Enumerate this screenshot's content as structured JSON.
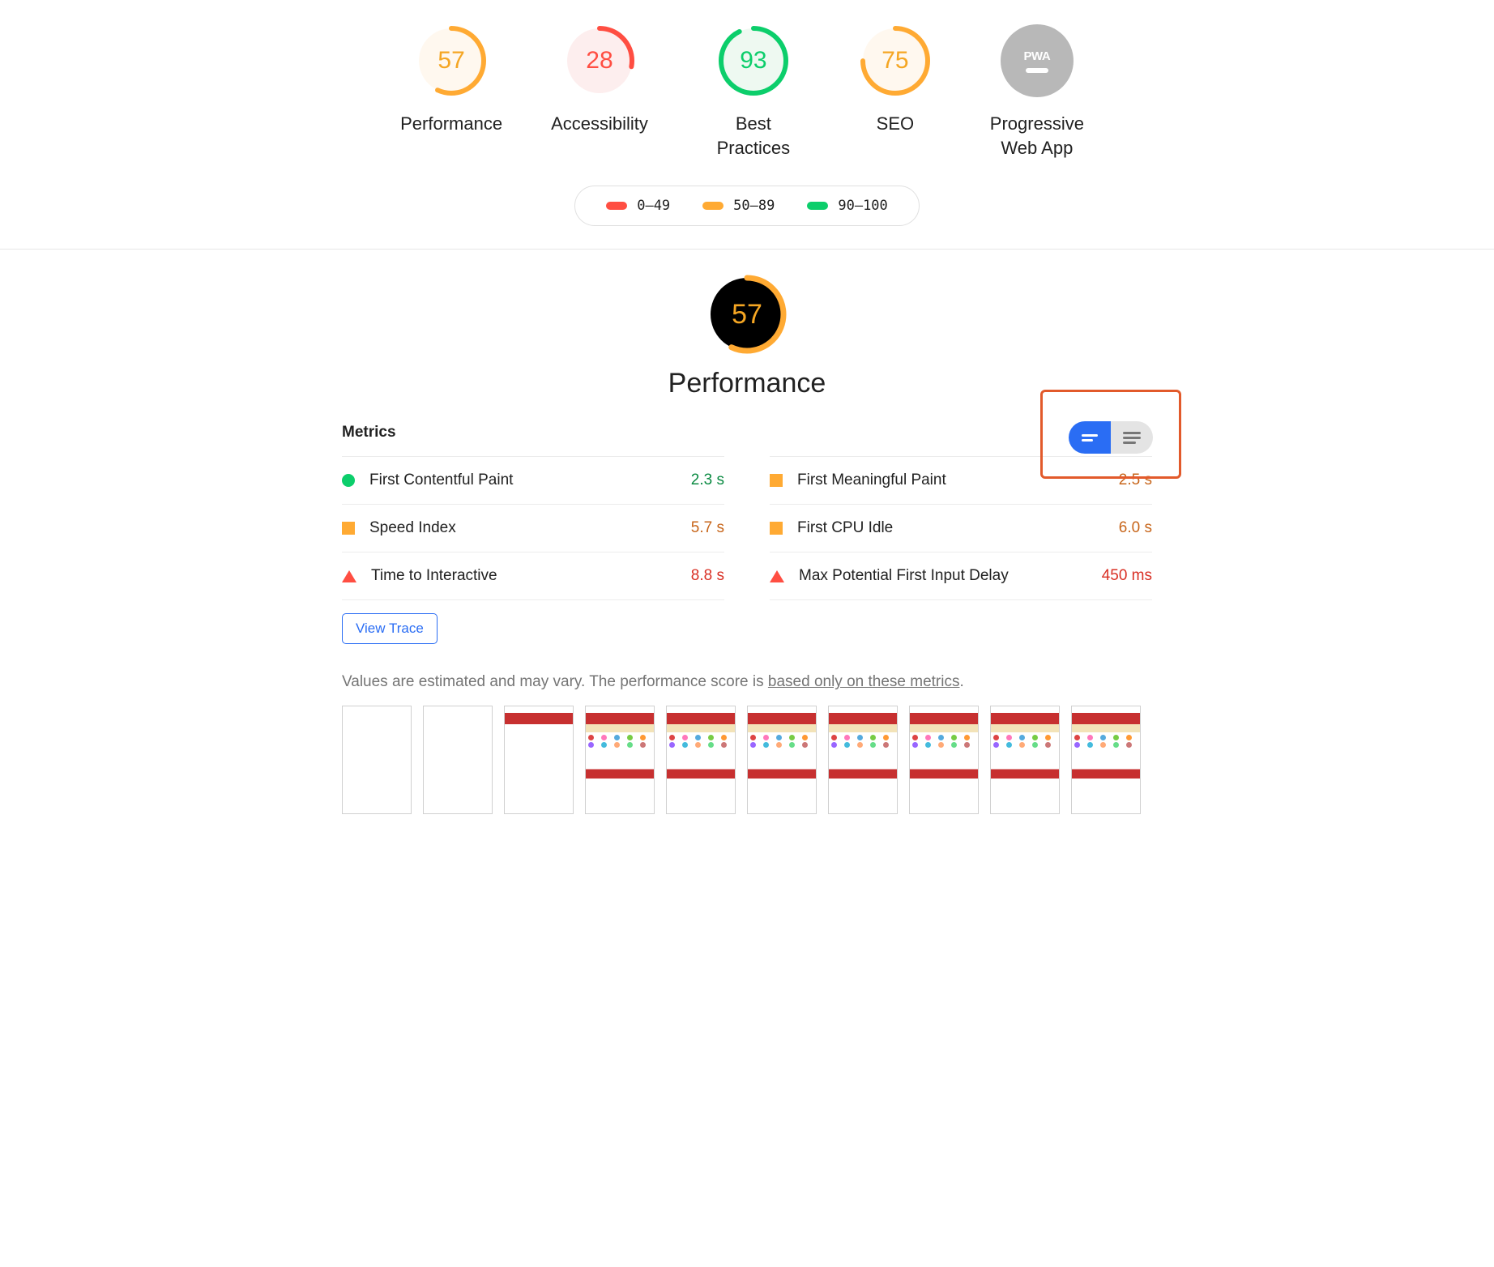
{
  "summary": {
    "gauges": [
      {
        "score": 57,
        "label": "Performance",
        "status": "orange"
      },
      {
        "score": 28,
        "label": "Accessibility",
        "status": "red"
      },
      {
        "score": 93,
        "label": "Best Practices",
        "status": "green"
      },
      {
        "score": 75,
        "label": "SEO",
        "status": "orange"
      }
    ],
    "pwa_label": "Progressive Web App",
    "pwa_badge_text": "PWA"
  },
  "legend": {
    "fail": "0–49",
    "average": "50–89",
    "pass": "90–100"
  },
  "chart_data": [
    {
      "type": "pie",
      "title": "Performance",
      "values": [
        57
      ],
      "ylim": [
        0,
        100
      ]
    },
    {
      "type": "pie",
      "title": "Accessibility",
      "values": [
        28
      ],
      "ylim": [
        0,
        100
      ]
    },
    {
      "type": "pie",
      "title": "Best Practices",
      "values": [
        93
      ],
      "ylim": [
        0,
        100
      ]
    },
    {
      "type": "pie",
      "title": "SEO",
      "values": [
        75
      ],
      "ylim": [
        0,
        100
      ]
    }
  ],
  "performance": {
    "score": 57,
    "title": "Performance",
    "metrics_title": "Metrics",
    "metrics": [
      {
        "name": "First Contentful Paint",
        "value": "2.3 s",
        "status": "green",
        "column": 0
      },
      {
        "name": "First Meaningful Paint",
        "value": "2.5 s",
        "status": "orange",
        "column": 1
      },
      {
        "name": "Speed Index",
        "value": "5.7 s",
        "status": "orange",
        "column": 0
      },
      {
        "name": "First CPU Idle",
        "value": "6.0 s",
        "status": "orange",
        "column": 1
      },
      {
        "name": "Time to Interactive",
        "value": "8.8 s",
        "status": "red",
        "column": 0
      },
      {
        "name": "Max Potential First Input Delay",
        "value": "450 ms",
        "status": "red",
        "column": 1
      }
    ],
    "view_trace_label": "View Trace",
    "note_prefix": "Values are estimated and may vary. The performance score is ",
    "note_link": "based only on these metrics",
    "note_suffix": ".",
    "filmstrip_frames": 10
  }
}
